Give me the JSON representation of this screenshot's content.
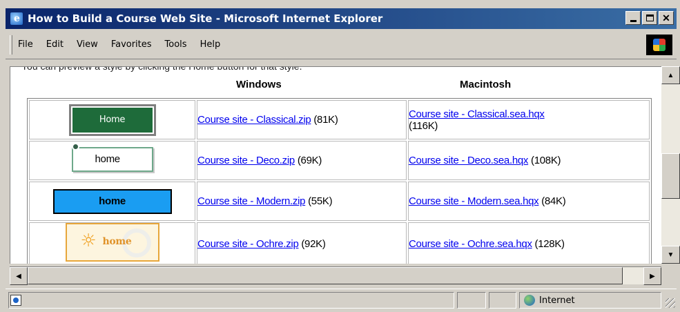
{
  "window": {
    "title": "How to Build a Course Web Site - Microsoft Internet Explorer",
    "minimize_glyph": "",
    "maximize_glyph": "",
    "close_glyph": "✕"
  },
  "menu": {
    "items": [
      {
        "label": "File"
      },
      {
        "label": "Edit"
      },
      {
        "label": "View"
      },
      {
        "label": "Favorites"
      },
      {
        "label": "Tools"
      },
      {
        "label": "Help"
      }
    ]
  },
  "page": {
    "intro": "You can preview a style by clicking the Home button for that style.",
    "headers": {
      "windows": "Windows",
      "mac": "Macintosh"
    },
    "rows": [
      {
        "style": "classical",
        "preview_label": "Home",
        "win_link": "Course site - Classical.zip",
        "win_size": "(81K)",
        "mac_link": "Course site - Classical.sea.hqx",
        "mac_size": "(116K)"
      },
      {
        "style": "deco",
        "preview_label": "home",
        "win_link": "Course site - Deco.zip",
        "win_size": "(69K)",
        "mac_link": "Course site - Deco.sea.hqx",
        "mac_size": "(108K)"
      },
      {
        "style": "modern",
        "preview_label": "home",
        "win_link": "Course site - Modern.zip",
        "win_size": "(55K)",
        "mac_link": "Course site - Modern.sea.hqx",
        "mac_size": "(84K)"
      },
      {
        "style": "ochre",
        "preview_label": "home",
        "win_link": "Course site - Ochre.zip",
        "win_size": "(92K)",
        "mac_link": "Course site - Ochre.sea.hqx",
        "mac_size": "(128K)"
      }
    ]
  },
  "statusbar": {
    "zone": "Internet"
  },
  "scrollbars": {
    "up_glyph": "▲",
    "down_glyph": "▼",
    "left_glyph": "◀",
    "right_glyph": "▶"
  },
  "colors": {
    "titlebar_start": "#0a246a",
    "titlebar_end": "#3a6ea5",
    "link": "#0000ee",
    "classical_green": "#1e6b3a",
    "modern_blue": "#1a9df2",
    "ochre": "#e7a63a"
  },
  "icons": {
    "title": "ie-page-icon",
    "logo": "windows-flag-icon",
    "status_page": "ie-page-icon",
    "status_zone": "globe-icon"
  }
}
